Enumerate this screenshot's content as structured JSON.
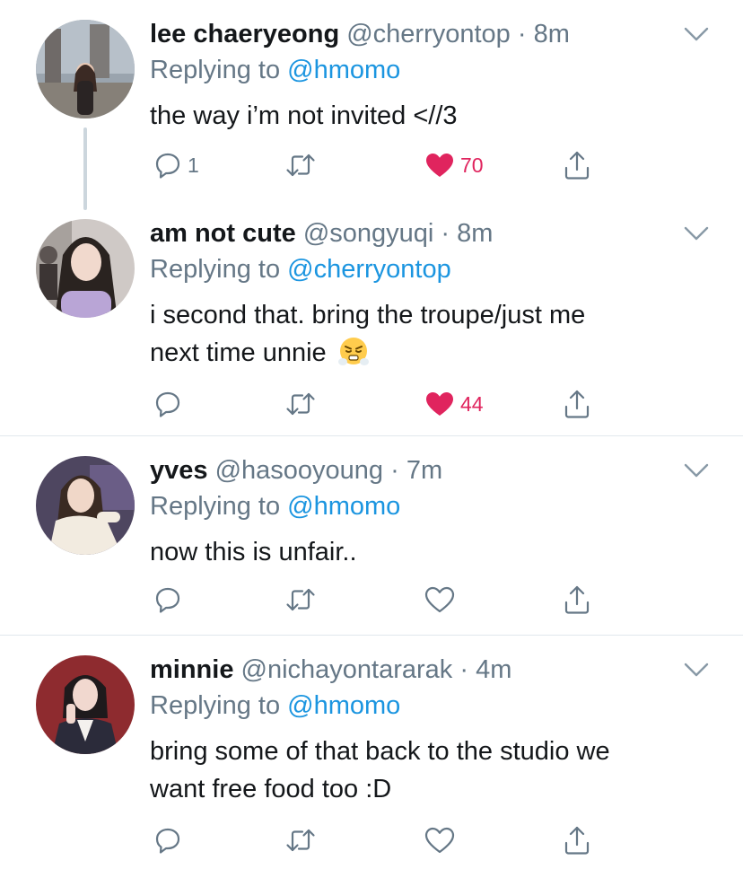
{
  "tweets": [
    {
      "display_name": "lee chaeryeong",
      "handle": "@cherryontop",
      "time": "8m",
      "replying_label": "Replying to",
      "replying_to": "@hmomo",
      "text_lines": [
        "the way i’m not invited <//3"
      ],
      "reply_count": "1",
      "like_count": "70",
      "liked": true,
      "avatar_colors": {
        "bg": "#8c97a3",
        "accent": "#3b3030"
      }
    },
    {
      "display_name": "am not cute",
      "handle": "@songyuqi",
      "time": "8m",
      "replying_label": "Replying to",
      "replying_to": "@cherryontop",
      "text_lines": [
        "i second that. bring the troupe/just me",
        "next time unnie"
      ],
      "emoji": "😤",
      "reply_count": "",
      "like_count": "44",
      "liked": true,
      "avatar_colors": {
        "bg": "#c9c3c0",
        "accent": "#2a2320"
      }
    },
    {
      "display_name": "yves",
      "handle": "@hasooyoung",
      "time": "7m",
      "replying_label": "Replying to",
      "replying_to": "@hmomo",
      "text_lines": [
        "now this is unfair.."
      ],
      "reply_count": "",
      "like_count": "",
      "liked": false,
      "avatar_colors": {
        "bg": "#5b4d6b",
        "accent": "#efe7dd"
      }
    },
    {
      "display_name": "minnie",
      "handle": "@nichayontararak",
      "time": "4m",
      "replying_label": "Replying to",
      "replying_to": "@hmomo",
      "text_lines": [
        "bring some of that back to the studio we",
        "want free food too :D"
      ],
      "reply_count": "",
      "like_count": "",
      "liked": false,
      "avatar_colors": {
        "bg": "#8e2b2f",
        "accent": "#2b2b3a"
      }
    }
  ],
  "colors": {
    "name": "#14171a",
    "secondary": "#657786",
    "mention": "#1b95e0",
    "like": "#e0245e",
    "divider": "#e1e8ed"
  }
}
